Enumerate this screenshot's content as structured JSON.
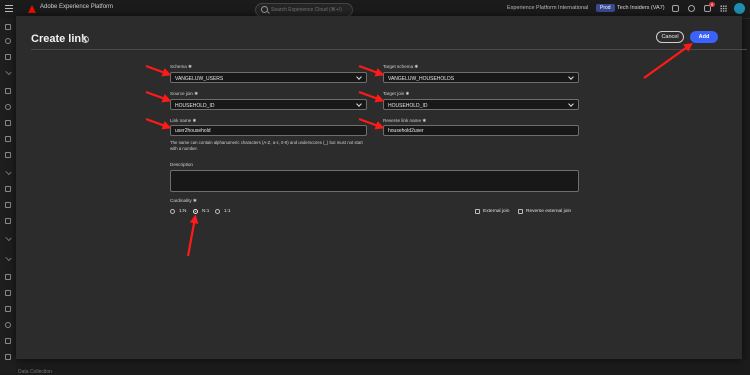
{
  "topbar": {
    "app_title": "Adobe Experience Platform",
    "search_placeholder": "Search Experience Cloud (⌘+/)",
    "org_name": "Experience Platform International",
    "prod_badge": "Prod",
    "sandbox_name": "Tech Insiders (VA7)",
    "notification_count": "9"
  },
  "modal": {
    "title": "Create link",
    "cancel_label": "Cancel",
    "add_label": "Add",
    "schema_label": "Schema ✱",
    "schema_value": "VANGELUW_USERS",
    "target_schema_label": "Target schema ✱",
    "target_schema_value": "VANGELUW_HOUSEHOLDS",
    "source_join_label": "Source join ✱",
    "source_join_value": "HOUSEHOLD_ID",
    "target_join_label": "Target join ✱",
    "target_join_value": "HOUSEHOLD_ID",
    "link_name_label": "Link name ✱",
    "link_name_value": "user2household",
    "reverse_link_name_label": "Reverse link name ✱",
    "reverse_link_name_value": "household2user",
    "help_text": "The name can contain alphanumeric characters (A-Z, a-z, 0-9) and underscores (_) but must not start with a number.",
    "description_label": "Description",
    "cardinality_label": "Cardinality ✱",
    "cardinality_options": [
      "1:N",
      "N:1",
      "1:1"
    ],
    "cardinality_selected": "N:1",
    "external_join_label": "External join",
    "reverse_external_join_label": "Reverse external join"
  },
  "bottom_text": "Data Collection",
  "colors": {
    "accent": "#3b63fb",
    "annotation_arrow": "#ff1a1a",
    "brand": "#eb1000"
  }
}
